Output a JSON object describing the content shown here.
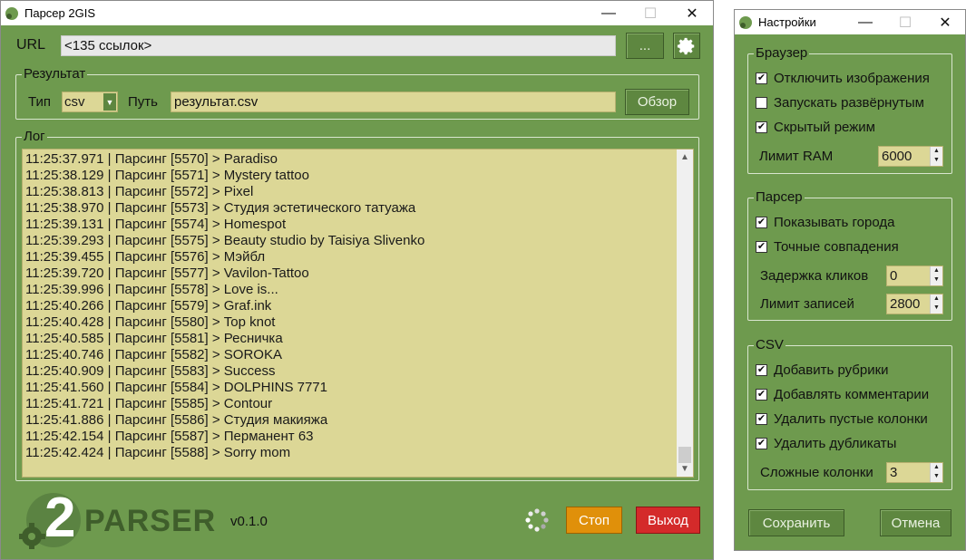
{
  "main": {
    "title": "Парсер 2GIS",
    "title_buttons": {
      "minimize": "—",
      "maximize": "☐",
      "close": "✕"
    },
    "url_label": "URL",
    "url_value": "<135 ссылок>",
    "url_button": "...",
    "result_group": "Результат",
    "type_label": "Тип",
    "type_value": "csv",
    "path_label": "Путь",
    "path_value": "результат.csv",
    "browse_button": "Обзор",
    "log_group": "Лог",
    "log_lines": [
      "11:25:37.971 | Парсинг [5570] > Paradiso",
      "11:25:38.129 | Парсинг [5571] > Mystery tattoo",
      "11:25:38.813 | Парсинг [5572] > Pixel",
      "11:25:38.970 | Парсинг [5573] > Студия эстетического татуажа",
      "11:25:39.131 | Парсинг [5574] > Homespot",
      "11:25:39.293 | Парсинг [5575] > Beauty studio by Taisiya Slivenko",
      "11:25:39.455 | Парсинг [5576] > Мэйбл",
      "11:25:39.720 | Парсинг [5577] > Vavilon-Tattoo",
      "11:25:39.996 | Парсинг [5578] > Love is...",
      "11:25:40.266 | Парсинг [5579] > Graf.ink",
      "11:25:40.428 | Парсинг [5580] > Top knot",
      "11:25:40.585 | Парсинг [5581] > Ресничка",
      "11:25:40.746 | Парсинг [5582] > SOROKA",
      "11:25:40.909 | Парсинг [5583] > Success",
      "11:25:41.560 | Парсинг [5584] > DOLPHINS 7771",
      "11:25:41.721 | Парсинг [5585] > Contour",
      "11:25:41.886 | Парсинг [5586] > Студия макияжа",
      "11:25:42.154 | Парсинг [5587] > Перманент 63",
      "11:25:42.424 | Парсинг [5588] > Sorry mom"
    ],
    "logo_number": "2",
    "logo_text": "PARSER",
    "version": "v0.1.0",
    "stop_button": "Стоп",
    "exit_button": "Выход",
    "colors": {
      "window_bg": "#6e9a4e",
      "field_yellow": "#dcd796",
      "stop": "#e0900a",
      "exit": "#d42a2a",
      "logo": "#3f5e2b"
    }
  },
  "settings": {
    "title": "Настройки",
    "title_buttons": {
      "minimize": "—",
      "maximize": "☐",
      "close": "✕"
    },
    "browser_group": "Браузер",
    "browser_checks": [
      {
        "label": "Отключить изображения",
        "checked": true
      },
      {
        "label": "Запускать развёрнутым",
        "checked": false
      },
      {
        "label": "Скрытый режим",
        "checked": true
      }
    ],
    "ram_label": "Лимит RAM",
    "ram_value": "6000",
    "parser_group": "Парсер",
    "parser_checks": [
      {
        "label": "Показывать города",
        "checked": true
      },
      {
        "label": "Точные совпадения",
        "checked": true
      }
    ],
    "delay_label": "Задержка кликов",
    "delay_value": "0",
    "records_label": "Лимит записей",
    "records_value": "2800",
    "csv_group": "CSV",
    "csv_checks": [
      {
        "label": "Добавить рубрики",
        "checked": true
      },
      {
        "label": "Добавлять комментарии",
        "checked": true
      },
      {
        "label": "Удалить пустые колонки",
        "checked": true
      },
      {
        "label": "Удалить дубликаты",
        "checked": true
      }
    ],
    "complex_label": "Сложные колонки",
    "complex_value": "3",
    "save_button": "Сохранить",
    "cancel_button": "Отмена"
  }
}
